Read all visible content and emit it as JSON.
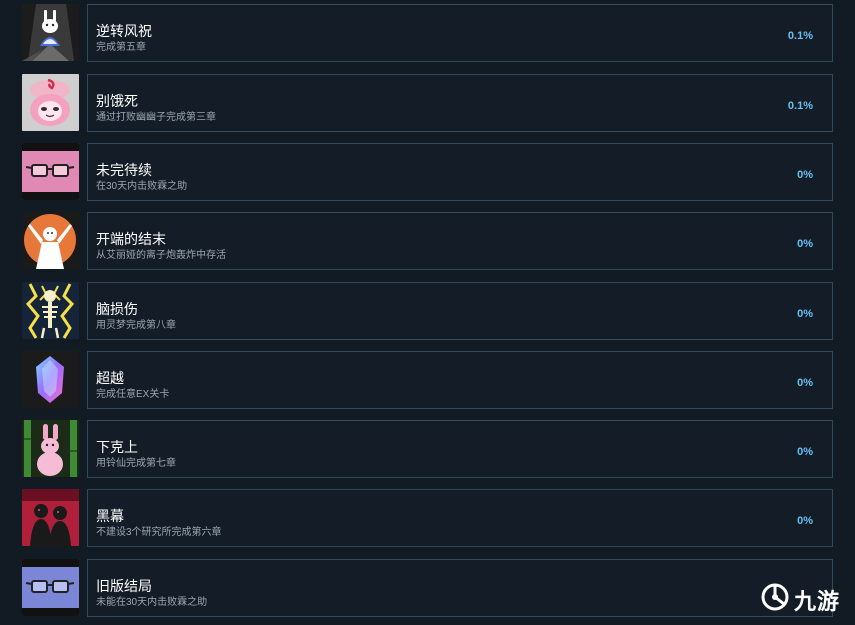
{
  "achievements": [
    {
      "title": "逆转风祝",
      "desc": "完成第五章",
      "percent": "0.1%",
      "icon": "bunny-shrine-icon"
    },
    {
      "title": "别饿死",
      "desc": "通过打败幽幽子完成第三章",
      "percent": "0.1%",
      "icon": "ghost-girl-icon"
    },
    {
      "title": "未完待续",
      "desc": "在30天内击败霖之助",
      "percent": "0%",
      "icon": "glasses-pink-icon"
    },
    {
      "title": "开端的结末",
      "desc": "从艾丽娅的离子炮轰炸中存活",
      "percent": "0%",
      "icon": "cheering-figure-icon"
    },
    {
      "title": "脑损伤",
      "desc": "用灵梦完成第八章",
      "percent": "0%",
      "icon": "lightning-skeleton-icon"
    },
    {
      "title": "超越",
      "desc": "完成任意EX关卡",
      "percent": "0%",
      "icon": "crystal-icon"
    },
    {
      "title": "下克上",
      "desc": "用铃仙完成第七章",
      "percent": "0%",
      "icon": "rabbit-bamboo-icon"
    },
    {
      "title": "黑幕",
      "desc": "不建设3个研究所完成第六章",
      "percent": "0%",
      "icon": "shadow-figures-icon"
    },
    {
      "title": "旧版结局",
      "desc": "未能在30天内击败霖之助",
      "percent": "",
      "icon": "glasses-blue-icon"
    }
  ],
  "watermark": {
    "text": "九游",
    "icon": "jiuyou-logo-icon"
  },
  "colors": {
    "background": "#121a23",
    "card_border": "#2e4a5c",
    "percent": "#66c0f4"
  }
}
